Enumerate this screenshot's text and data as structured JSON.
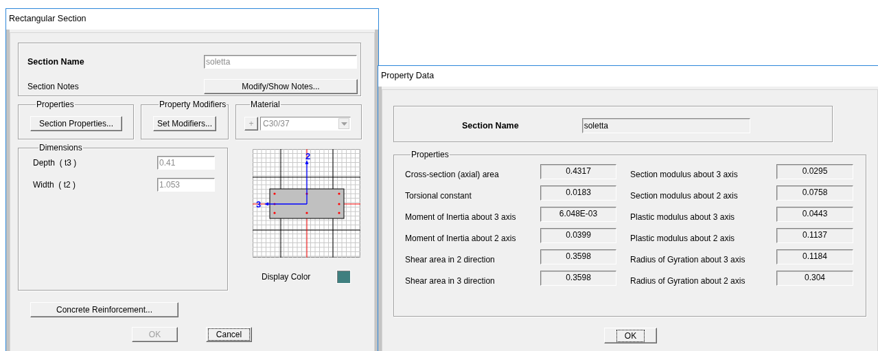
{
  "section_dialog": {
    "title": "Rectangular Section",
    "section_name": {
      "label": "Section Name",
      "value": "soletta",
      "disabled": true
    },
    "section_notes": {
      "label": "Section Notes",
      "button": "Modify/Show Notes..."
    },
    "properties_group": {
      "title": "Properties",
      "button": "Section Properties..."
    },
    "modifiers_group": {
      "title": "Property Modifiers",
      "button": "Set Modifiers..."
    },
    "material_group": {
      "title": "Material",
      "add_button": "+",
      "value": "C30/37",
      "disabled": true
    },
    "dimensions": {
      "title": "Dimensions",
      "fields": [
        {
          "label": "Depth  ( t3 )",
          "value": "0.41",
          "disabled": true
        },
        {
          "label": "Width  ( t2 )",
          "value": "1.053",
          "disabled": true
        }
      ]
    },
    "diagram": {
      "vertical_axis_label": "2",
      "horizontal_axis_label": "3"
    },
    "display_color": {
      "label": "Display Color",
      "color": "#3f7f7f"
    },
    "reinforcement_button": "Concrete Reinforcement...",
    "buttons": [
      {
        "label": "OK",
        "disabled": true,
        "focused": false
      },
      {
        "label": "Cancel",
        "disabled": false,
        "focused": true
      }
    ]
  },
  "property_dialog": {
    "title": "Property Data",
    "section_name": {
      "label": "Section Name",
      "value": "soletta"
    },
    "properties_title": "Properties",
    "rows": [
      {
        "label": "Cross-section (axial) area",
        "value": "0.4317",
        "label_2": "Section modulus about 3 axis",
        "value_2": "0.0295"
      },
      {
        "label": "Torsional constant",
        "value": "0.0183",
        "label_2": "Section modulus about 2 axis",
        "value_2": "0.0758"
      },
      {
        "label": "Moment of Inertia about 3 axis",
        "value": "6.048E-03",
        "label_2": "Plastic modulus about 3 axis",
        "value_2": "0.0443"
      },
      {
        "label": "Moment of Inertia about 2 axis",
        "value": "0.0399",
        "label_2": "Plastic modulus about 2 axis",
        "value_2": "0.1137"
      },
      {
        "label": "Shear area in 2 direction",
        "value": "0.3598",
        "label_2": "Radius of Gyration about 3 axis",
        "value_2": "0.1184"
      },
      {
        "label": "Shear area in 3 direction",
        "value": "0.3598",
        "label_2": "Radius of Gyration about 2 axis",
        "value_2": "0.304"
      }
    ],
    "ok_button": {
      "label": "OK",
      "focused": true
    }
  }
}
